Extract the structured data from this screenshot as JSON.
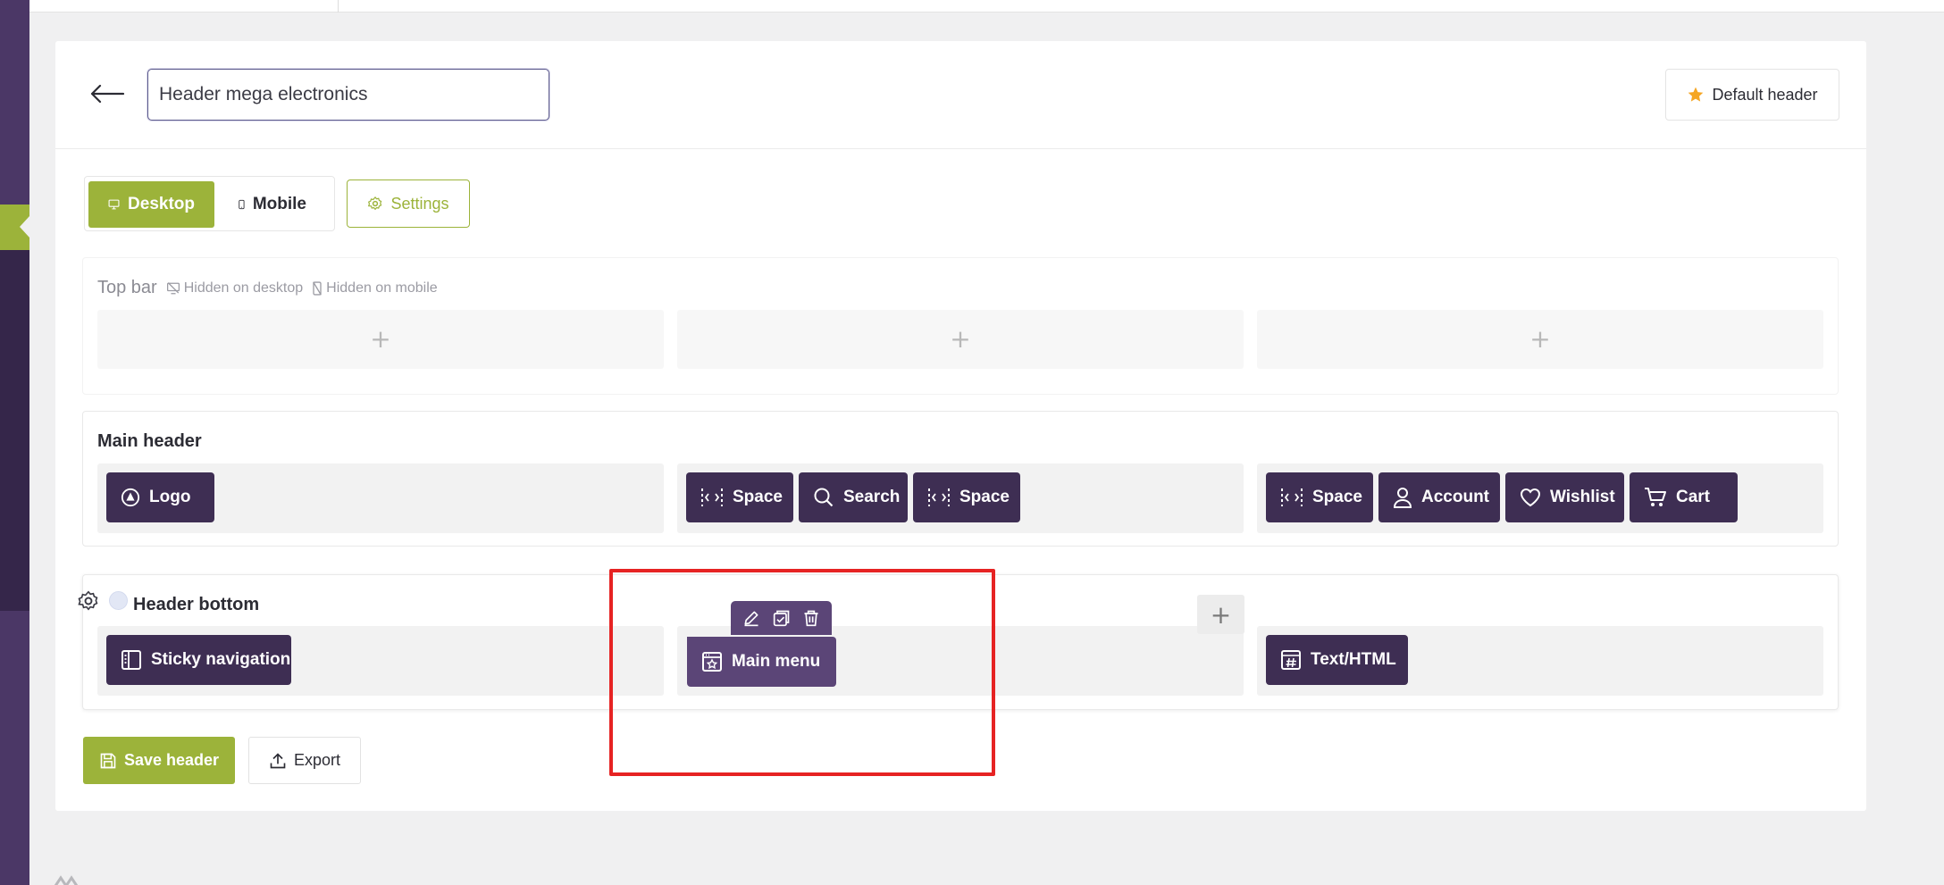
{
  "header_name": "Header mega electronics",
  "default_header_label": "Default header",
  "views": {
    "desktop_label": "Desktop",
    "mobile_label": "Mobile",
    "settings_label": "Settings"
  },
  "top_bar": {
    "title": "Top bar",
    "hidden_desktop": "Hidden on desktop",
    "hidden_mobile": "Hidden on mobile"
  },
  "main_header": {
    "title": "Main header",
    "left": [
      "Logo"
    ],
    "center": [
      "Space",
      "Search",
      "Space"
    ],
    "right": [
      "Space",
      "Account",
      "Wishlist",
      "Cart"
    ]
  },
  "header_bottom": {
    "title": "Header bottom",
    "left": [
      "Sticky navigation"
    ],
    "center": [
      "Main menu"
    ],
    "right": [
      "Text/HTML"
    ]
  },
  "actions": {
    "save_label": "Save header",
    "export_label": "Export"
  },
  "colors": {
    "accent": "#9cb33a",
    "block": "#3e2e53",
    "block_active": "#5b4577",
    "sidebar": "#4b3766",
    "highlight": "#e62323"
  }
}
